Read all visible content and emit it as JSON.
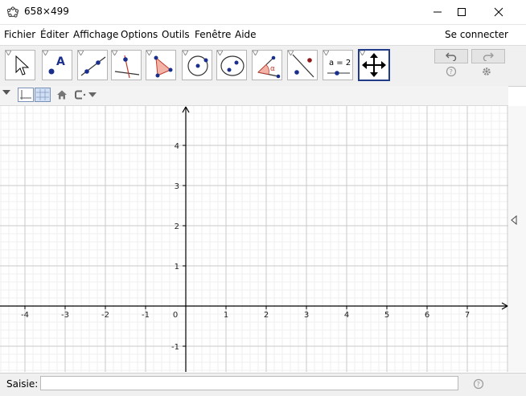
{
  "window": {
    "title": "658×499"
  },
  "menu": [
    "Fichier",
    "Éditer",
    "Affichage",
    "Options",
    "Outils",
    "Fenêtre",
    "Aide"
  ],
  "login_label": "Se connecter",
  "tools": [
    {
      "name": "move-tool-icon"
    },
    {
      "name": "point-tool-icon"
    },
    {
      "name": "line-tool-icon"
    },
    {
      "name": "perpendicular-tool-icon"
    },
    {
      "name": "polygon-tool-icon"
    },
    {
      "name": "circle-tool-icon"
    },
    {
      "name": "ellipse-tool-icon"
    },
    {
      "name": "angle-tool-icon"
    },
    {
      "name": "reflect-tool-icon"
    },
    {
      "name": "slider-tool-icon",
      "label": "a = 2"
    },
    {
      "name": "move-graphics-view-icon"
    }
  ],
  "input_bar": {
    "label": "Saisie:",
    "value": ""
  },
  "axes": {
    "x_ticks": [
      "-4",
      "-3",
      "-2",
      "-1",
      "0",
      "1",
      "2",
      "3",
      "4",
      "5",
      "6",
      "7"
    ],
    "y_ticks": [
      "4",
      "3",
      "2",
      "1",
      "-1"
    ]
  }
}
